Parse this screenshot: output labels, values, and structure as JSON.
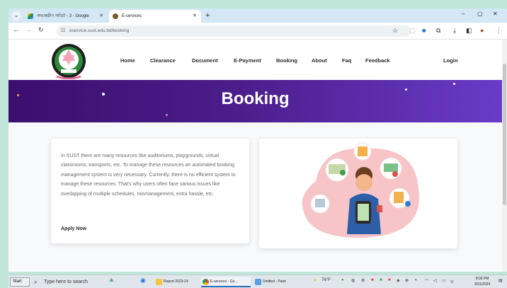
{
  "browser": {
    "tabs": [
      {
        "title": "অভ্যন্তরীণ অডিট - 3 - Google"
      },
      {
        "title": "E-services"
      }
    ],
    "new_tab": "+",
    "window_controls": {
      "minimize": "–",
      "maximize": "▢",
      "close": "✕"
    },
    "url": "eservice.sust.edu.bd/booking"
  },
  "site": {
    "nav": [
      "Home",
      "Clearance",
      "Document",
      "E-Payment",
      "Booking",
      "About",
      "Faq",
      "Feedback"
    ],
    "login": "Login",
    "hero_title": "Booking",
    "description": "In SUST there are many resources like auditoriums, playgrounds, virtual classrooms, transports, etc. To manage these resources an automated booking management system is very necessary. Currently, there is no efficient system to manage these resources. That's why users often face various issues like overlapping of multiple schedules, mismanagement, extra hassle, etc.",
    "apply_label": "Apply Now"
  },
  "taskbar": {
    "start": "Start",
    "search_placeholder": "Type here to search",
    "apps": [
      {
        "label": "Report 2023-24"
      },
      {
        "label": "E-services - Go..."
      },
      {
        "label": "Untitled - Paint"
      }
    ],
    "weather": "76°F",
    "time": "8:06 PM",
    "date": "3/31/2024"
  },
  "colors": {
    "hero_start": "#3a0f6e",
    "hero_end": "#6a3bc7",
    "taskbar_bg": "#dfe6ec",
    "frame_bg": "#bfe6d8"
  }
}
